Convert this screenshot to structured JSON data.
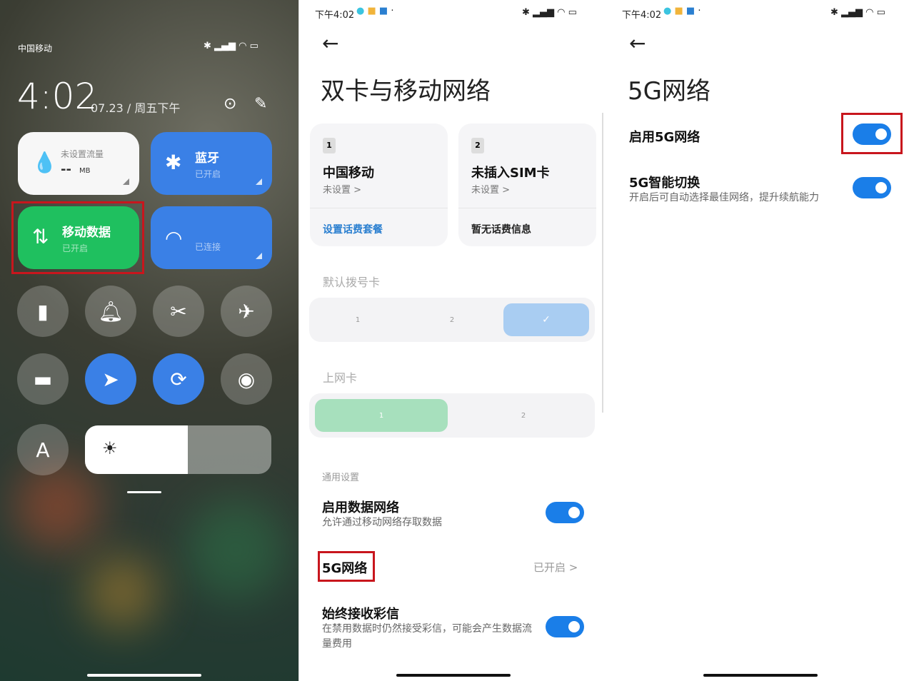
{
  "control_center": {
    "carrier": "中国移动",
    "time": "4:02",
    "date": "07.23 / 周五下午",
    "data_tile": {
      "title": "未设置流量",
      "value": "--",
      "unit": "MB"
    },
    "bluetooth_tile": {
      "title": "蓝牙",
      "status": "已开启"
    },
    "mobile_data_tile": {
      "title": "移动数据",
      "status": "已开启"
    },
    "wifi_tile": {
      "status": "已连接"
    },
    "toggles": [
      "flashlight-icon",
      "bell-icon",
      "screenshot-icon",
      "airplane-icon",
      "lock-icon",
      "location-icon",
      "rotation-lock-icon",
      "eye-icon"
    ],
    "auto_brightness": "A",
    "brightness_percent": 55,
    "accent": "#3a80e6",
    "green": "#1fc05f",
    "highlight": "#c8161d"
  },
  "sim_screen": {
    "status_time": "下午4:02",
    "title": "双卡与移动网络",
    "sim1": {
      "num": "1",
      "name": "中国移动",
      "sub": "未设置 >",
      "foot": "设置话费套餐"
    },
    "sim2": {
      "num": "2",
      "name": "未插入SIM卡",
      "sub": "未设置 >",
      "foot": "暂无话费信息"
    },
    "default_dial_label": "默认拨号卡",
    "dial_opts": [
      "1",
      "2",
      "✓"
    ],
    "data_card_label": "上网卡",
    "data_opts": [
      "1",
      "2"
    ],
    "general_label": "通用设置",
    "enable_data": {
      "title": "启用数据网络",
      "sub": "允许通过移动网络存取数据",
      "on": true
    },
    "fiveg": {
      "title": "5G网络",
      "value": "已开启 >"
    },
    "mms": {
      "title": "始终接收彩信",
      "sub": "在禁用数据时仍然接受彩信，可能会产生数据流量费用",
      "on": true
    }
  },
  "fiveg_screen": {
    "status_time": "下午4:02",
    "title": "5G网络",
    "enable": {
      "title": "启用5G网络",
      "on": true
    },
    "smart": {
      "title": "5G智能切换",
      "sub": "开启后可自动选择最佳网络，提升续航能力",
      "on": true
    }
  }
}
